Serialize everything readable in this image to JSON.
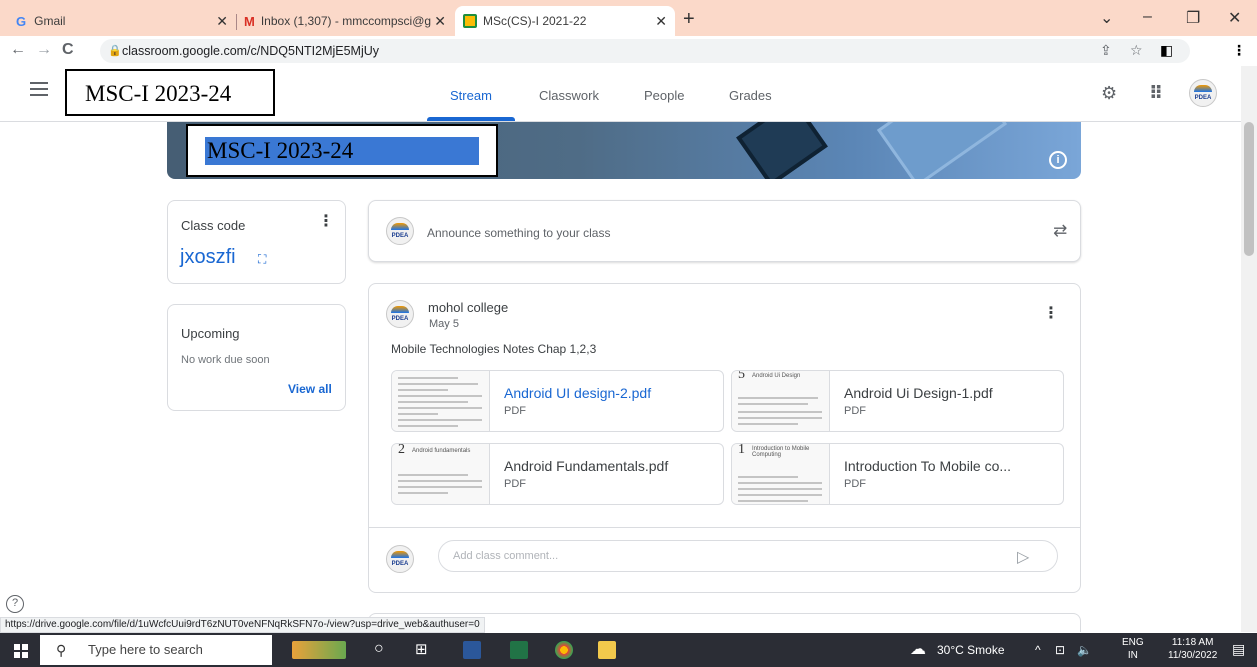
{
  "browser": {
    "tabs": [
      {
        "label": "Gmail",
        "favicon": "google-g-icon"
      },
      {
        "label": "Inbox (1,307) - mmccompsci@gm",
        "favicon": "gmail-icon"
      },
      {
        "label": "MSc(CS)-I 2021-22",
        "favicon": "classroom-icon"
      }
    ],
    "url": "classroom.google.com/c/NDQ5NTI2MjE5MjUy"
  },
  "header": {
    "class_name": "MSC-I 2023-24",
    "tabs": [
      "Stream",
      "Classwork",
      "People",
      "Grades"
    ],
    "active_tab": "Stream"
  },
  "banner": {
    "title": "MSC-I 2023-24"
  },
  "class_code": {
    "title": "Class code",
    "code": "jxoszfi"
  },
  "upcoming": {
    "title": "Upcoming",
    "empty_text": "No work due soon",
    "view_all": "View all"
  },
  "announce": {
    "placeholder": "Announce something to your class"
  },
  "post": {
    "author": "mohol college",
    "date": "May 5",
    "body": "Mobile Technologies Notes Chap 1,2,3",
    "attachments": [
      {
        "name": "Android UI design-2.pdf",
        "type": "PDF",
        "thumb_head": "",
        "thumb_sub": ""
      },
      {
        "name": "Android Ui Design-1.pdf",
        "type": "PDF",
        "thumb_head": "5",
        "thumb_sub": "Android Ui Design"
      },
      {
        "name": "Android Fundamentals.pdf",
        "type": "PDF",
        "thumb_head": "2",
        "thumb_sub": "Android fundamentals"
      },
      {
        "name": "Introduction To Mobile co...",
        "type": "PDF",
        "thumb_head": "1",
        "thumb_sub": "Introduction to Mobile Computing"
      }
    ],
    "comment_placeholder": "Add class comment..."
  },
  "avatar_text": "PDEA",
  "status_url": "https://drive.google.com/file/d/1uWcfcUui9rdT6zNUT0veNFNqRkSFN7o-/view?usp=drive_web&authuser=0",
  "taskbar": {
    "search_placeholder": "Type here to search",
    "weather": "30°C  Smoke",
    "lang_top": "ENG",
    "lang_bottom": "IN",
    "time": "11:18 AM",
    "date": "11/30/2022"
  },
  "colors": {
    "accent": "#1967d2",
    "tab_strip": "#fbd9c9"
  }
}
